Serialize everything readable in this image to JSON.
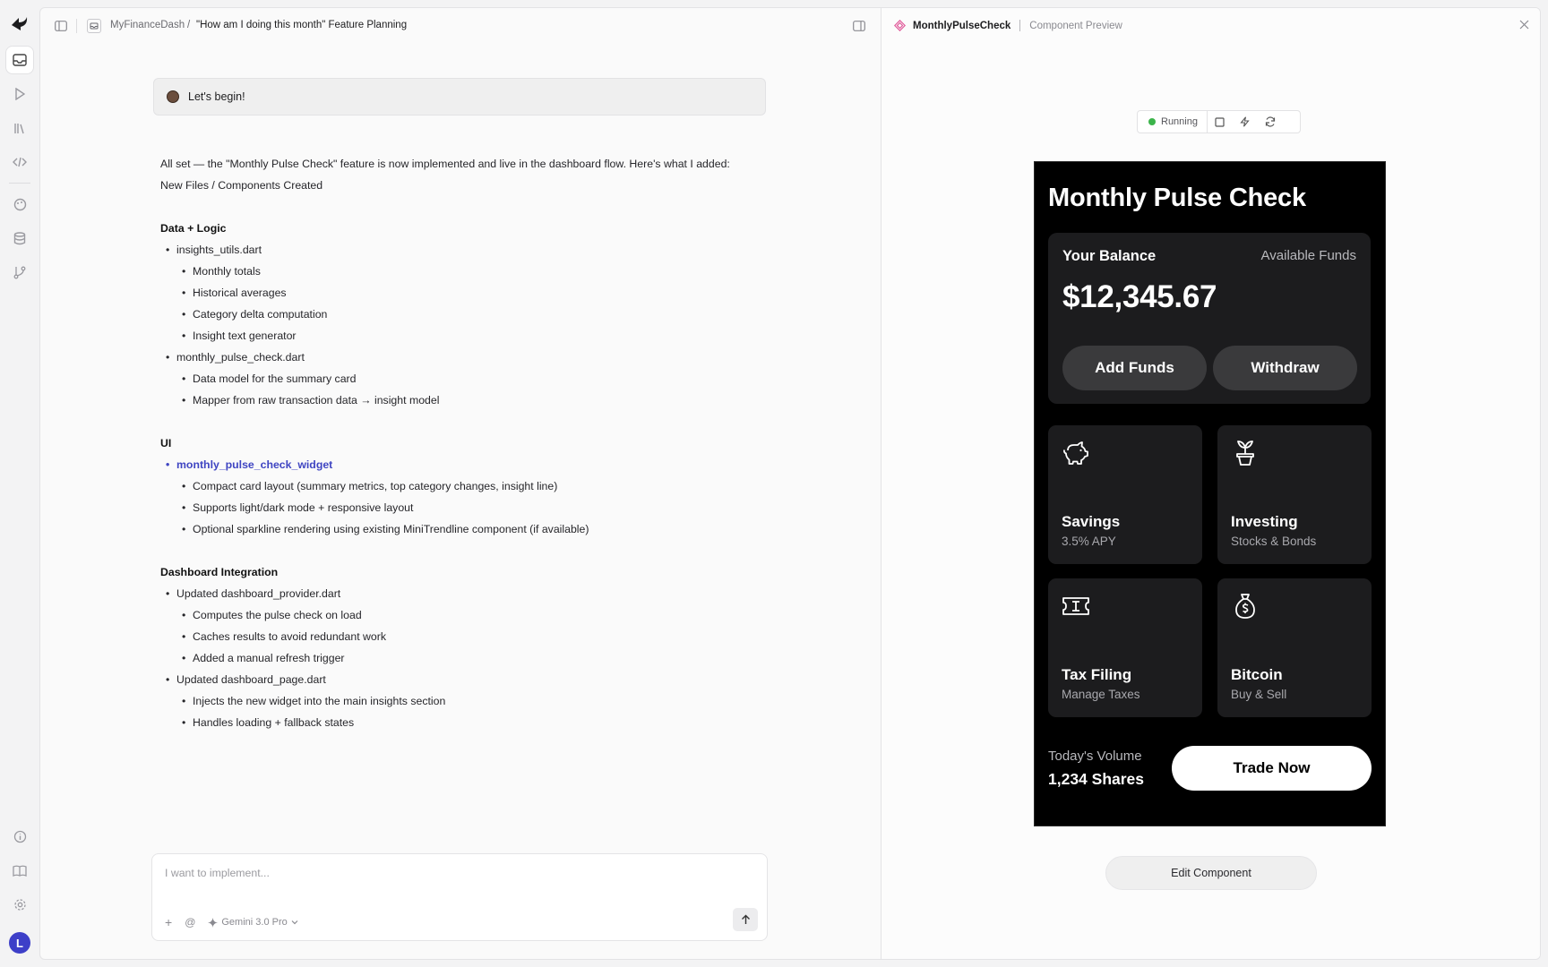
{
  "app": {
    "user_initial": "L"
  },
  "breadcrumb": {
    "project": "MyFinanceDash",
    "separator": "/",
    "page": "\"How am I doing this month\" Feature Planning"
  },
  "chat": {
    "user_message": "Let's begin!",
    "reply": {
      "intro": "All set — the \"Monthly Pulse Check\" feature is now implemented and live in the dashboard flow. Here's what I added:",
      "subtitle": "New Files / Components Created",
      "sections": [
        {
          "heading": "Data + Logic",
          "items": [
            {
              "label": "insights_utils.dart",
              "sub": [
                "Monthly totals",
                "Historical averages",
                "Category delta computation",
                "Insight text generator"
              ]
            },
            {
              "label": "monthly_pulse_check.dart",
              "sub": [
                "Data model for the summary card",
                "Mapper from raw transaction data → insight model"
              ]
            }
          ]
        },
        {
          "heading": "UI",
          "items": [
            {
              "label": "monthly_pulse_check_widget",
              "sub": [
                "Compact card layout (summary metrics, top category changes, insight line)",
                "Supports light/dark mode + responsive layout",
                "Optional sparkline rendering using existing MiniTrendline component (if available)"
              ]
            }
          ]
        },
        {
          "heading": "Dashboard Integration",
          "items": [
            {
              "label": "Updated dashboard_provider.dart",
              "sub": [
                "Computes the pulse check on load",
                "Caches results to avoid redundant work",
                "Added a manual refresh trigger"
              ]
            },
            {
              "label": "Updated dashboard_page.dart",
              "sub": [
                "Injects the new widget into the main insights section",
                "Handles loading + fallback states"
              ]
            }
          ]
        }
      ]
    },
    "composer": {
      "placeholder": "I want to implement...",
      "model": "Gemini 3.0 Pro"
    }
  },
  "preview": {
    "component_name": "MonthlyPulseCheck",
    "panel_label": "Component Preview",
    "status": "Running",
    "status_color": "#3cb44b",
    "phone": {
      "title": "Monthly Pulse Check",
      "balance_label": "Your Balance",
      "available_label": "Available Funds",
      "balance": "$12,345.67",
      "add_funds": "Add Funds",
      "withdraw": "Withdraw",
      "tiles": [
        {
          "title": "Savings",
          "subtitle": "3.5% APY",
          "icon": "piggy-bank-icon"
        },
        {
          "title": "Investing",
          "subtitle": "Stocks & Bonds",
          "icon": "plant-icon"
        },
        {
          "title": "Tax Filing",
          "subtitle": "Manage Taxes",
          "icon": "ticket-icon"
        },
        {
          "title": "Bitcoin",
          "subtitle": "Buy & Sell",
          "icon": "money-bag-icon"
        }
      ],
      "volume_label": "Today's Volume",
      "volume_value": "1,234 Shares",
      "trade_button": "Trade Now"
    },
    "edit_button": "Edit Component"
  }
}
